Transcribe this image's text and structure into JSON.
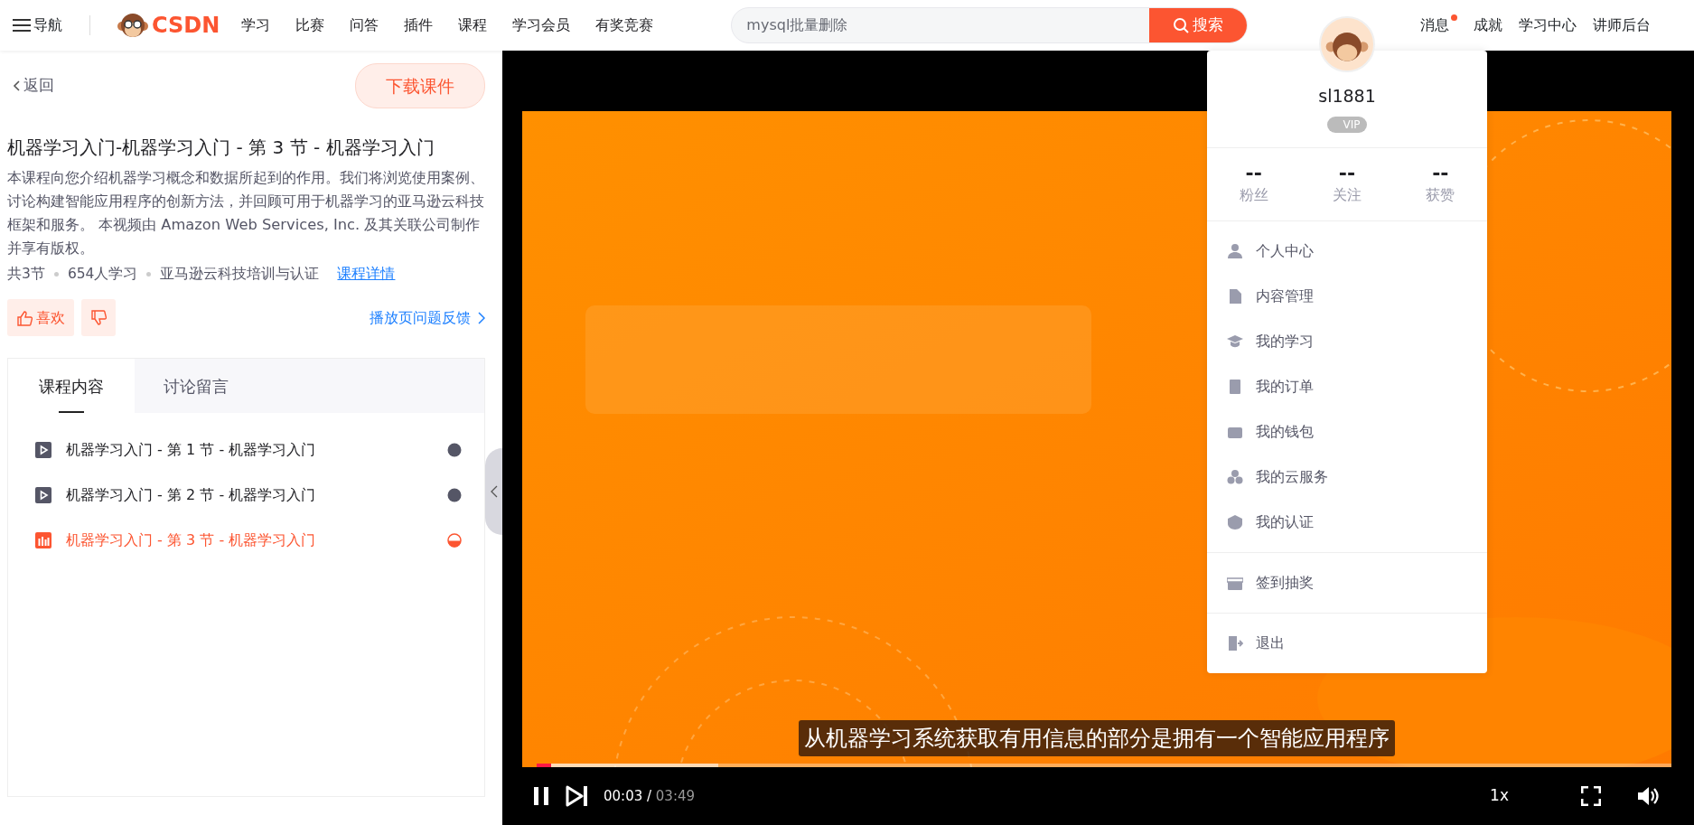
{
  "nav": {
    "menu_label": "导航",
    "logo_text": "CSDN",
    "links": [
      "学习",
      "比赛",
      "问答",
      "插件",
      "课程",
      "学习会员",
      "有奖竞赛"
    ],
    "search": {
      "placeholder": "mysql批量删除",
      "button": "搜索"
    },
    "right_links": [
      {
        "label": "消息",
        "badge": true
      },
      {
        "label": "成就",
        "badge": false
      },
      {
        "label": "学习中心",
        "badge": false
      },
      {
        "label": "讲师后台",
        "badge": false
      }
    ]
  },
  "course": {
    "back": "返回",
    "download": "下载课件",
    "title": "机器学习入门-机器学习入门 - 第 3 节 - 机器学习入门",
    "description": "本课程向您介绍机器学习概念和数据所起到的作用。我们将浏览使用案例、讨论构建智能应用程序的创新方法，并回顾可用于机器学习的亚马逊云科技框架和服务。 本视频由 Amazon Web Services, Inc. 及其关联公司制作并享有版权。",
    "meta": [
      "共3节",
      "654人学习",
      "亚马逊云科技培训与认证"
    ],
    "details_link": "课程详情",
    "like": "喜欢",
    "feedback": "播放页问题反馈",
    "tabs": [
      {
        "label": "课程内容",
        "selected": true
      },
      {
        "label": "讨论留言",
        "selected": false
      }
    ],
    "lessons": [
      {
        "title": "机器学习入门 - 第 1 节 - 机器学习入门",
        "selected": false,
        "kind": "finished"
      },
      {
        "title": "机器学习入门 - 第 2 节 - 机器学习入门",
        "selected": false,
        "kind": "finished"
      },
      {
        "title": "机器学习入门 - 第 3 节 - 机器学习入门",
        "selected": true,
        "kind": "partial"
      }
    ]
  },
  "player": {
    "subtitle": "从机器学习系统获取有用信息的部分是拥有一个智能应用程序",
    "playing": true,
    "time_current": "00:03",
    "time_separator": "/",
    "time_total": "03:49",
    "speed": "1x",
    "progress": {
      "level": 0.013
    },
    "buffer": {
      "level": 0.16
    }
  },
  "user_menu": {
    "username": "sl1881",
    "vip": "VIP",
    "stats": [
      {
        "value": "--",
        "label": "粉丝"
      },
      {
        "value": "--",
        "label": "关注"
      },
      {
        "value": "--",
        "label": "获赞"
      }
    ],
    "groups": [
      [
        "个人中心",
        "内容管理",
        "我的学习",
        "我的订单",
        "我的钱包",
        "我的云服务",
        "我的认证"
      ],
      [
        "签到抽奖"
      ],
      [
        "退出"
      ]
    ]
  }
}
